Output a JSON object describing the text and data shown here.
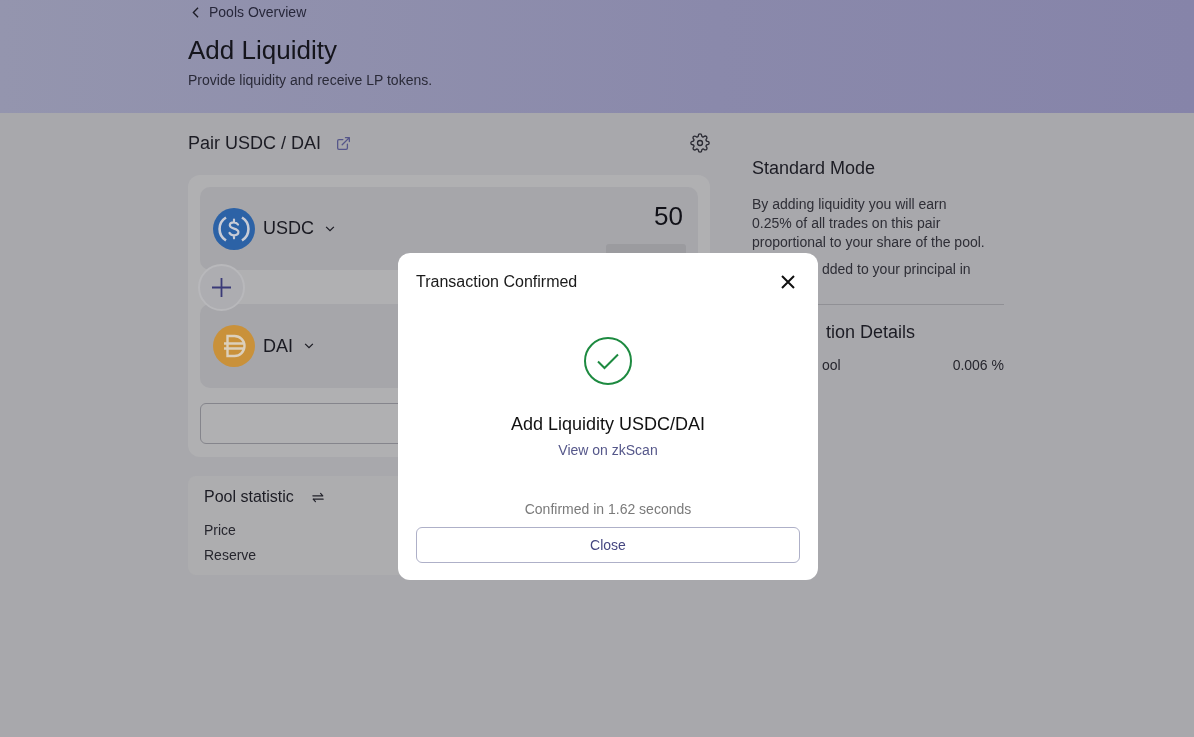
{
  "back_link": {
    "label": "Pools Overview"
  },
  "header": {
    "title": "Add Liquidity",
    "subtitle": "Provide liquidity and receive LP tokens."
  },
  "pair": {
    "label": "Pair USDC / DAI"
  },
  "tokens": [
    {
      "symbol": "USDC",
      "kind": "usdc",
      "amount": "50"
    },
    {
      "symbol": "DAI",
      "kind": "dai"
    }
  ],
  "pool_statistic": {
    "title": "Pool statistic",
    "rows": [
      "Price",
      "Reserve"
    ]
  },
  "info": {
    "title": "Standard Mode",
    "description_lines": [
      "By adding liquidity you will earn",
      "0.25% of all trades on this pair",
      "proportional to your share of the pool."
    ],
    "description_cut": "dded to your principal in"
  },
  "details": {
    "title": "tion Details",
    "rows": [
      {
        "label": "ool",
        "value": "0.006 %"
      }
    ]
  },
  "modal": {
    "title": "Transaction Confirmed",
    "heading": "Add Liquidity USDC/DAI",
    "link": "View on zkScan",
    "note": "Confirmed in 1.62 seconds",
    "button": "Close"
  }
}
